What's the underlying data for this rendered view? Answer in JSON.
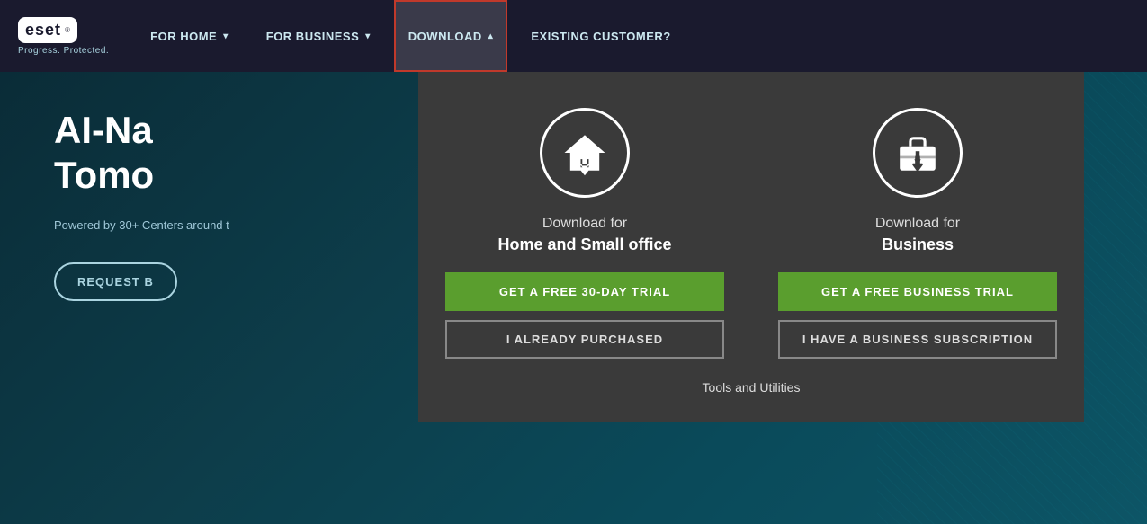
{
  "navbar": {
    "logo": "eset",
    "logo_tm": "®",
    "tagline": "Progress. Protected.",
    "items": [
      {
        "id": "for-home",
        "label": "FOR HOME",
        "has_arrow": true,
        "active": false
      },
      {
        "id": "for-business",
        "label": "FOR BUSINESS",
        "has_arrow": true,
        "active": false
      },
      {
        "id": "download",
        "label": "DOWNLOAD",
        "has_arrow": true,
        "active": true
      },
      {
        "id": "existing-customer",
        "label": "EXISTING CUSTOMER?",
        "has_arrow": false,
        "active": false
      }
    ]
  },
  "hero": {
    "title_line1": "AI-Na",
    "title_line2": "Tomo",
    "subtitle": "Powered by 30+\nCenters around t",
    "btn_label": "REQUEST B"
  },
  "dropdown": {
    "home_col": {
      "icon": "home",
      "title": "Download for",
      "subtitle": "Home and Small office",
      "btn_trial": "GET A FREE 30-DAY TRIAL",
      "btn_purchased": "I ALREADY PURCHASED"
    },
    "business_col": {
      "icon": "business",
      "title": "Download for",
      "subtitle": "Business",
      "btn_trial": "GET A FREE BUSINESS TRIAL",
      "btn_subscription": "I HAVE A BUSINESS SUBSCRIPTION"
    },
    "tools_link": "Tools and Utilities"
  }
}
